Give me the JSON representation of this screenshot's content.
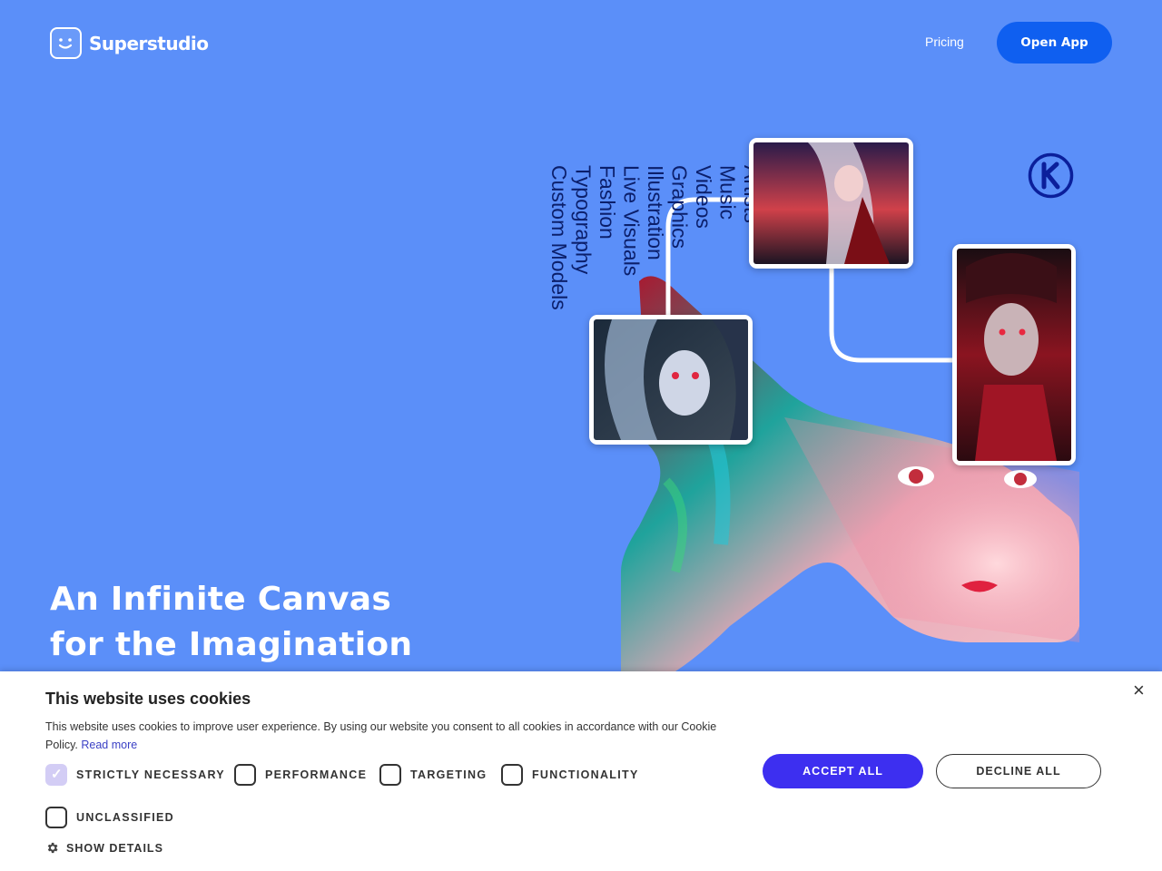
{
  "header": {
    "brand": "Superstudio",
    "nav_pricing": "Pricing",
    "cta": "Open App"
  },
  "hero": {
    "line1": "An Infinite Canvas",
    "line2": "for the Imagination"
  },
  "categories": [
    "Artists",
    "Music",
    "Videos",
    "Graphics",
    "Illustration",
    "Live Visuals",
    "Fashion",
    "Typography",
    "Custom Models"
  ],
  "cookie": {
    "title": "This website uses cookies",
    "text": "This website uses cookies to improve user experience. By using our website you consent to all cookies in accordance with our Cookie Policy.",
    "read_more": "Read more",
    "options": [
      {
        "label": "STRICTLY NECESSARY",
        "checked": true
      },
      {
        "label": "PERFORMANCE",
        "checked": false
      },
      {
        "label": "TARGETING",
        "checked": false
      },
      {
        "label": "FUNCTIONALITY",
        "checked": false
      },
      {
        "label": "UNCLASSIFIED",
        "checked": false
      }
    ],
    "accept": "ACCEPT ALL",
    "decline": "DECLINE ALL",
    "show_details": "SHOW DETAILS",
    "close": "×"
  },
  "colors": {
    "background": "#5b8ff9",
    "cta": "#0f5ff0",
    "accept": "#3d2ff0"
  },
  "icons": [
    "smile-logo-icon",
    "k-badge-icon",
    "gear-icon",
    "close-icon",
    "check-icon"
  ]
}
